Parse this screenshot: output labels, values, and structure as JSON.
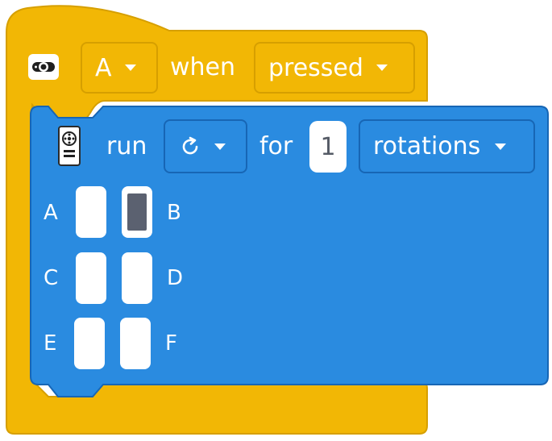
{
  "hat": {
    "icon": "remote-control-icon",
    "button_value": "A",
    "when_label": "when",
    "event_value": "pressed"
  },
  "motor_block": {
    "icon": "multi-motor-icon",
    "run_label": "run",
    "direction": "rotate-clockwise-icon",
    "for_label": "for",
    "amount": "1",
    "unit_value": "rotations",
    "ports": [
      {
        "label": "A",
        "selected": false
      },
      {
        "label": "B",
        "selected": true
      },
      {
        "label": "C",
        "selected": false
      },
      {
        "label": "D",
        "selected": false
      },
      {
        "label": "E",
        "selected": false
      },
      {
        "label": "F",
        "selected": false
      }
    ]
  },
  "colors": {
    "hat_yellow": "#F2B705",
    "motor_blue": "#2A8BE0",
    "selected_port": "#5B6170"
  }
}
